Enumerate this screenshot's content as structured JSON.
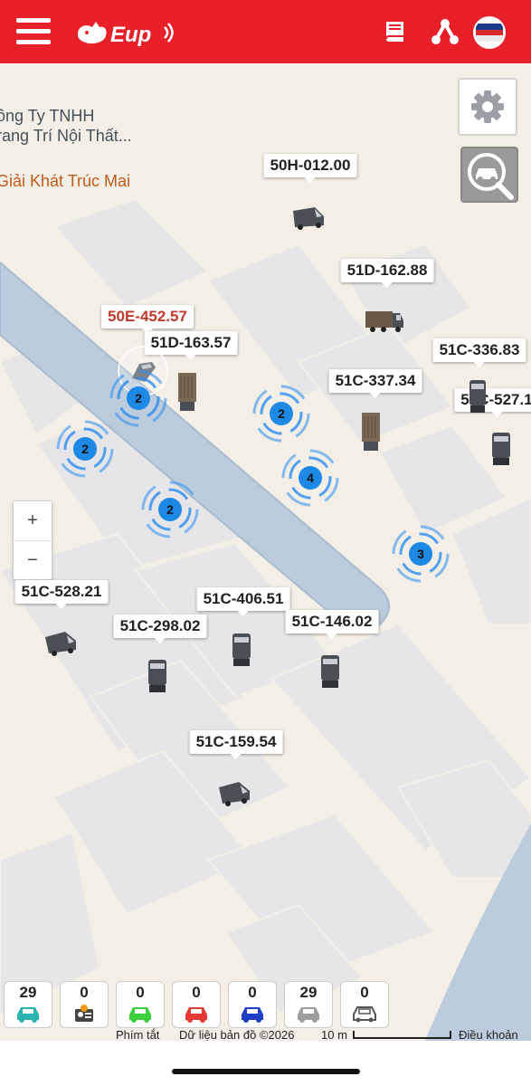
{
  "header": {
    "brand": "Eup",
    "brand_color": "#e8202a",
    "icons": [
      "menu-icon",
      "book-icon",
      "share-icon",
      "language-flag-icon"
    ]
  },
  "map": {
    "pois": [
      {
        "text": "ông Ty TNHH",
        "style": "gray"
      },
      {
        "text": "rang Trí Nội Thất...",
        "style": "gray"
      },
      {
        "text": "Giải Khát Trúc Mai",
        "style": "orange"
      }
    ],
    "zoom": {
      "in": "+",
      "out": "−"
    },
    "vehicles": [
      {
        "plate": "50H-012.00",
        "kind": "van",
        "alert": false
      },
      {
        "plate": "51D-162.88",
        "kind": "truck",
        "alert": false
      },
      {
        "plate": "50E-452.57",
        "kind": "car",
        "alert": true
      },
      {
        "plate": "51D-163.57",
        "kind": "container",
        "alert": false
      },
      {
        "plate": "51C-336.83",
        "kind": "box-truck",
        "alert": false
      },
      {
        "plate": "51C-337.34",
        "kind": "container",
        "alert": false
      },
      {
        "plate": "51C-527.1",
        "kind": "box-truck",
        "alert": false
      },
      {
        "plate": "51C-528.21",
        "kind": "van",
        "alert": false
      },
      {
        "plate": "51C-406.51",
        "kind": "box-truck",
        "alert": false
      },
      {
        "plate": "51C-298.02",
        "kind": "box-truck",
        "alert": false
      },
      {
        "plate": "51C-146.02",
        "kind": "box-truck",
        "alert": false
      },
      {
        "plate": "51C-159.54",
        "kind": "van",
        "alert": false
      }
    ],
    "clusters": [
      "2",
      "2",
      "2",
      "2",
      "4",
      "3"
    ]
  },
  "status_bar": [
    {
      "count": "29",
      "label": "running",
      "color": "#2bb3b1"
    },
    {
      "count": "0",
      "label": "license-alert",
      "color": "#f39c12"
    },
    {
      "count": "0",
      "label": "idle",
      "color": "#3ccf3c"
    },
    {
      "count": "0",
      "label": "stopped-alert",
      "color": "#e53935"
    },
    {
      "count": "0",
      "label": "blue",
      "color": "#1f3fc8"
    },
    {
      "count": "29",
      "label": "offline",
      "color": "#9e9e9e"
    },
    {
      "count": "0",
      "label": "no-signal",
      "color": "#555555"
    }
  ],
  "attribution": {
    "shortcuts": "Phím tắt",
    "map_data": "Dữ liệu bản đồ ©2026",
    "scale": "10 m",
    "terms": "Điều khoản"
  }
}
